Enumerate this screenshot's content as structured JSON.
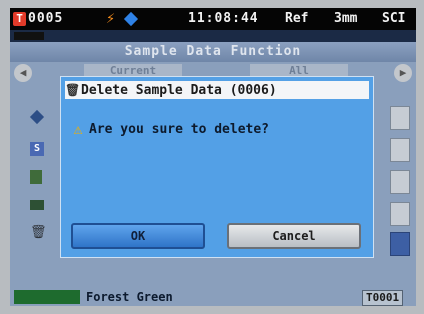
{
  "status_bar": {
    "t_badge": "T",
    "sample_number": "0005",
    "time": "11:08:44",
    "reference": "Ref",
    "aperture": "3mm",
    "mode": "SCI"
  },
  "panel": {
    "title": "Sample Data Function",
    "tab_current": "Current",
    "tab_all": "All"
  },
  "dialog": {
    "title": "Delete Sample Data (0006)",
    "message": "Are you sure to delete?",
    "ok_label": "OK",
    "cancel_label": "Cancel"
  },
  "bottom_bar": {
    "color_name": "Forest Green",
    "target_id": "T0001"
  },
  "icons": {
    "battery": "bolt-icon",
    "connection": "diamond-icon",
    "trash": "trash-icon",
    "warning": "warning-icon"
  },
  "colors": {
    "dialog_bg": "#53a0e6",
    "ok_button": "#2f74c8",
    "swatch": "#1e6b2e",
    "status_badge": "#e23b2a"
  }
}
